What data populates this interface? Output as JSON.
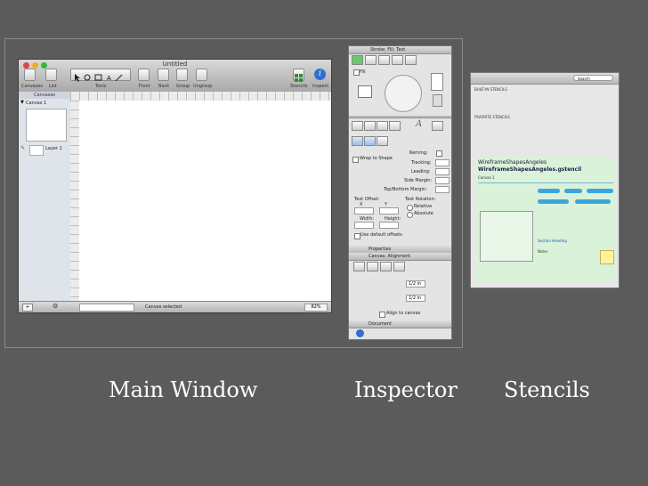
{
  "captions": {
    "main_window": "Main Window",
    "inspector": "Inspector",
    "stencils": "Stencils"
  },
  "main_window": {
    "title": "Untitled",
    "toolbar": {
      "canvases": "Canvases",
      "list": "List",
      "tools": "Tools",
      "front": "Front",
      "back": "Back",
      "group": "Group",
      "ungroup": "Ungroup",
      "stencils": "Stencils",
      "inspect": "Inspect"
    },
    "sidebar": {
      "header": "Canvases",
      "canvas_item": "Canvas 1",
      "layer_item": "Layer 1"
    },
    "status": {
      "text": "Canvas selected",
      "zoom": "82%"
    }
  },
  "inspector": {
    "title": "Stroke: Fill: Text",
    "fill_label": "Fill",
    "text_tab": "A",
    "kerning": "Kerning:",
    "tracking": "Tracking:",
    "leading": "Leading:",
    "wrap_to_shape": "Wrap to Shape",
    "side_margin": "Side Margin:",
    "top_bottom_margin": "Top/Bottom Margin:",
    "text_offset": "Text Offset:",
    "text_rotation": "Text Rotation:",
    "x": "X",
    "y": "Y",
    "width": "Width:",
    "height": "Height:",
    "relative": "Relative",
    "absolute": "Absolute",
    "use_default_offsets": "Use default offsets",
    "properties": "Properties",
    "canvas_alignment": "Canvas: Alignment",
    "field_1": "1/2 in",
    "field_2": "1/2 in",
    "align_to_canvas": "Align to canvas",
    "document": "Document"
  },
  "stencils": {
    "search_placeholder": "Search",
    "section_1": "BUILT-IN STENCILS",
    "section_2": "FAVORITE STENCILS",
    "heading": "WireframeShapesAngeles",
    "subheading": "WireframeShapesAngeles.gstencil",
    "canvas_label": "Canvas 1",
    "section_heading": "Section Heading",
    "notes_label": "Notes"
  },
  "colors": {
    "background": "#5b5b5b",
    "stencil_green": "#d9f2d9",
    "stencil_blue": "#3aa6dc"
  }
}
